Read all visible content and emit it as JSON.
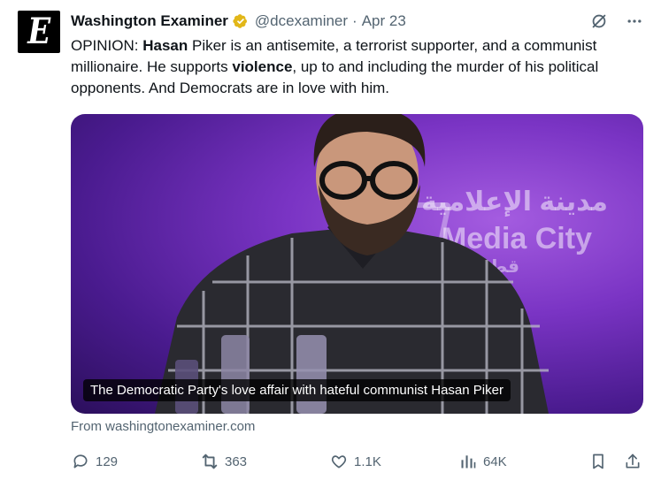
{
  "tweet": {
    "author_name": "Washington Examiner",
    "handle": "@dcexaminer",
    "separator": "·",
    "date": "Apr 23",
    "avatar_letter": "E",
    "text": {
      "part1": "OPINION: ",
      "bold1": "Hasan",
      "part2": " Piker is an antisemite, a terrorist supporter, and a communist millionaire. He supports ",
      "bold2": "violence",
      "part3": ", up to and including the murder of his political opponents. And Democrats are in love with him."
    }
  },
  "card": {
    "caption": "The Democratic Party's love affair with hateful communist Hasan Piker",
    "background_arabic": "مدينة الإعلامية",
    "background_brand": "Media City",
    "background_sub": "Qatar قطر",
    "source": "From washingtonexaminer.com"
  },
  "actions": {
    "replies": "129",
    "reposts": "363",
    "likes": "1.1K",
    "views": "64K"
  },
  "icons": {
    "verified": "verified-badge-icon",
    "grok": "grok-icon",
    "more": "more-icon",
    "reply": "reply-icon",
    "repost": "repost-icon",
    "like": "like-icon",
    "views": "views-icon",
    "bookmark": "bookmark-icon",
    "share": "share-icon"
  },
  "colors": {
    "text": "#0f1419",
    "secondary": "#536471",
    "verified_gold": "#e2b719",
    "card_purple": "#7a34c4"
  }
}
